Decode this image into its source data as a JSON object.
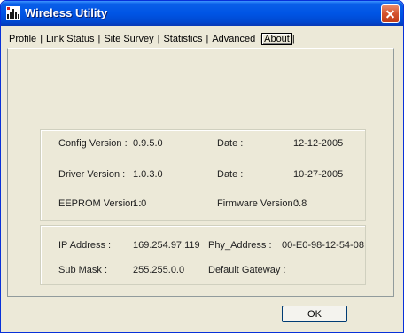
{
  "window": {
    "title": "Wireless Utility"
  },
  "tabs": [
    {
      "label": "Profile"
    },
    {
      "label": "Link Status"
    },
    {
      "label": "Site Survey"
    },
    {
      "label": "Statistics"
    },
    {
      "label": "Advanced"
    },
    {
      "label": "About"
    }
  ],
  "active_tab": "About",
  "version_info": {
    "config_version_label": "Config Version :",
    "config_version_value": "0.9.5.0",
    "config_date_label": "Date :",
    "config_date_value": "12-12-2005",
    "driver_version_label": "Driver Version :",
    "driver_version_value": "1.0.3.0",
    "driver_date_label": "Date :",
    "driver_date_value": "10-27-2005",
    "eeprom_version_label": "EEPROM Version :",
    "eeprom_version_value": "1.0",
    "firmware_version_label": "Firmware Version :",
    "firmware_version_value": "0.8"
  },
  "network_info": {
    "ip_address_label": "IP Address :",
    "ip_address_value": "169.254.97.119",
    "phy_address_label": "Phy_Address :",
    "phy_address_value": "00-E0-98-12-54-08",
    "sub_mask_label": "Sub Mask :",
    "sub_mask_value": "255.255.0.0",
    "default_gateway_label": "Default Gateway :",
    "default_gateway_value": ""
  },
  "buttons": {
    "ok_label": "OK"
  },
  "colors": {
    "title_bar": "#0055e5",
    "window_bg": "#ece9d8",
    "close_button": "#d4522d"
  }
}
